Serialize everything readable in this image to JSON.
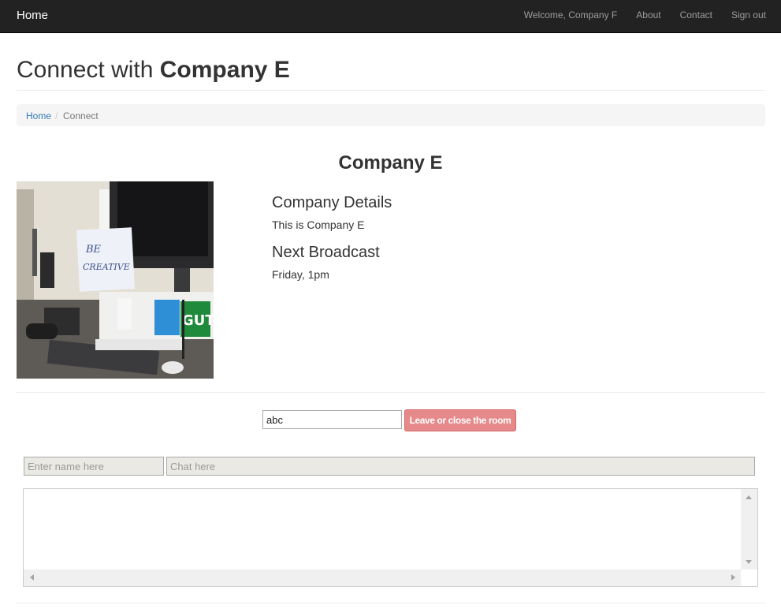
{
  "navbar": {
    "brand": "Home",
    "welcome": "Welcome, Company F",
    "links": [
      "About",
      "Contact",
      "Sign out"
    ]
  },
  "header": {
    "title_prefix": "Connect with ",
    "title_company": "Company E"
  },
  "breadcrumb": {
    "home": "Home",
    "separator": "/",
    "current": "Connect"
  },
  "company": {
    "name": "Company E",
    "photo": {
      "note_text_line1": "BE",
      "note_text_line2": "CREATIVE",
      "sticker_text": "GUT"
    },
    "details_heading": "Company Details",
    "details_text": "This is Company E",
    "broadcast_heading": "Next Broadcast",
    "broadcast_text": "Friday, 1pm"
  },
  "room": {
    "input_value": "abc",
    "leave_label": "Leave or close the room"
  },
  "chat": {
    "name_placeholder": "Enter name here",
    "message_placeholder": "Chat here"
  },
  "colors": {
    "navbar_bg": "#222222",
    "link": "#337ab7",
    "leave_button": "#e5898a",
    "chat_input_bg": "#ebe9e3"
  }
}
